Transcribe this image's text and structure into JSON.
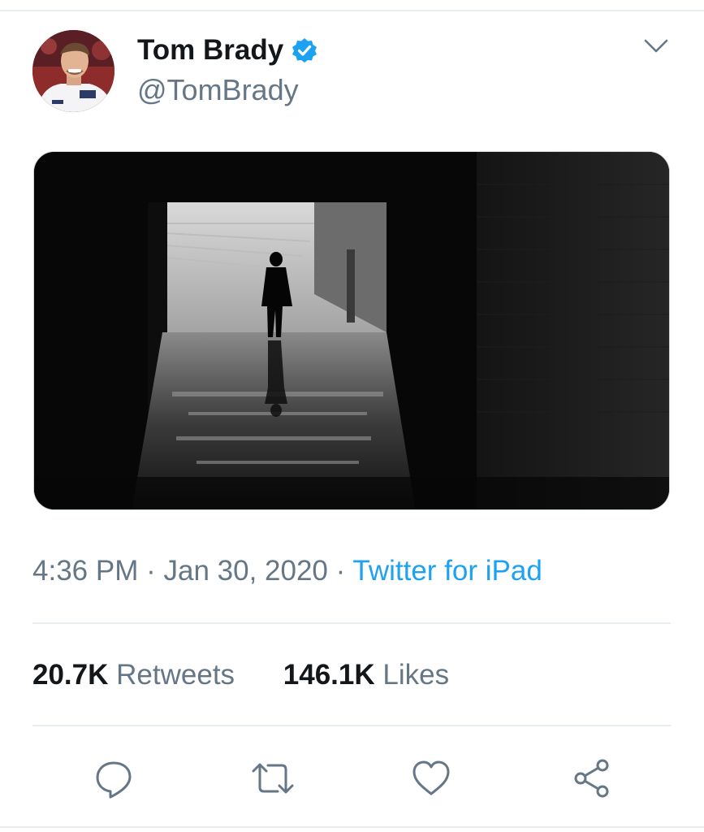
{
  "tweet": {
    "author": {
      "display_name": "Tom Brady",
      "handle": "@TomBrady",
      "verified": true,
      "verified_icon": "verified-badge-icon",
      "avatar_icon": "profile-photo"
    },
    "menu_icon": "chevron-down-icon",
    "media": {
      "kind": "photo",
      "subject": "silhouette of a man walking through a stadium tunnel, reflected on wet floor"
    },
    "time": "4:36 PM",
    "separator": "·",
    "date": "Jan 30, 2020",
    "source": "Twitter for iPad",
    "stats": {
      "retweets_count": "20.7K",
      "retweets_label": "Retweets",
      "likes_count": "146.1K",
      "likes_label": "Likes"
    },
    "actions": [
      "reply-icon",
      "retweet-icon",
      "like-icon",
      "share-icon"
    ]
  },
  "colors": {
    "text_primary": "#14171a",
    "text_secondary": "#657786",
    "accent": "#1da1f2",
    "divider": "#e6ecf0"
  }
}
